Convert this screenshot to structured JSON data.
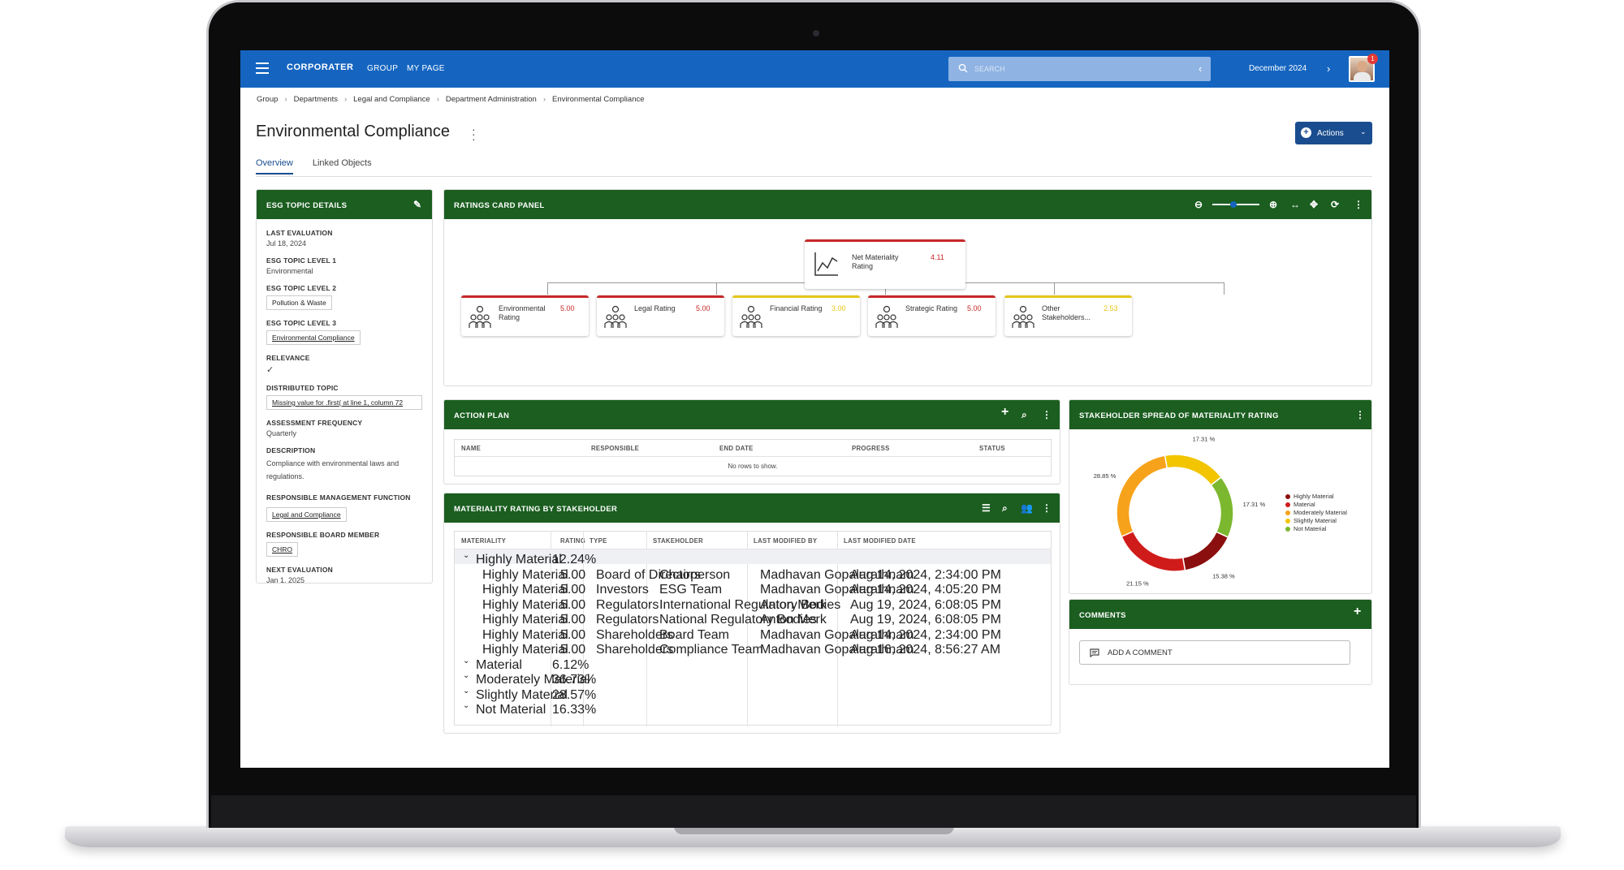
{
  "topbar": {
    "logo": "CORPORATER",
    "nav": [
      "GROUP",
      "MY PAGE"
    ],
    "search_placeholder": "SEARCH",
    "period": "December 2024",
    "notifications": "1"
  },
  "breadcrumb": [
    "Group",
    "Departments",
    "Legal and Compliance",
    "Department Administration",
    "Environmental Compliance"
  ],
  "page_title": "Environmental Compliance",
  "actions_label": "Actions",
  "tabs": [
    "Overview",
    "Linked Objects"
  ],
  "esg": {
    "header": "ESG TOPIC DETAILS",
    "last_eval_label": "LAST EVALUATION",
    "last_eval": "Jul 18, 2024",
    "level1_label": "ESG TOPIC LEVEL 1",
    "level1": "Environmental",
    "level2_label": "ESG TOPIC LEVEL 2",
    "level2": "Pollution & Waste",
    "level3_label": "ESG TOPIC LEVEL 3",
    "level3": "Environmental Compliance",
    "relevance_label": "RELEVANCE",
    "relevance": "✓",
    "distributed_label": "DISTRIBUTED TOPIC",
    "distributed": "Missing value for .first( at line 1, column 72",
    "frequency_label": "ASSESSMENT FREQUENCY",
    "frequency": "Quarterly",
    "description_label": "DESCRIPTION",
    "description": "Compliance with environmental laws and regulations.",
    "rmf_label": "RESPONSIBLE MANAGEMENT FUNCTION",
    "rmf": "Legal and Compliance",
    "board_label": "RESPONSIBLE BOARD MEMBER",
    "board": "CHRO",
    "next_eval_label": "NEXT EVALUATION",
    "next_eval": "Jan 1, 2025"
  },
  "ratings": {
    "header": "RATINGS CARD PANEL",
    "root": {
      "label": "Net Materiality Rating",
      "value": "4.11",
      "color": "#c62828"
    },
    "children": [
      {
        "label": "Environmental Rating",
        "value": "5.00",
        "color": "#c62828"
      },
      {
        "label": "Legal Rating",
        "value": "5.00",
        "color": "#c62828"
      },
      {
        "label": "Financial Rating",
        "value": "3.00",
        "color": "#e6c619"
      },
      {
        "label": "Strategic Rating",
        "value": "5.00",
        "color": "#c62828"
      },
      {
        "label": "Other Stakeholders...",
        "value": "2.53",
        "color": "#e6c619"
      }
    ]
  },
  "action_plan": {
    "header": "ACTION PLAN",
    "columns": [
      "NAME",
      "RESPONSIBLE",
      "END DATE",
      "PROGRESS",
      "STATUS"
    ],
    "empty": "No rows to show."
  },
  "materiality": {
    "header": "MATERIALITY RATING BY STAKEHOLDER",
    "columns": [
      "MATERIALITY",
      "RATING",
      "TYPE",
      "STAKEHOLDER",
      "LAST MODIFIED BY",
      "LAST MODIFIED DATE"
    ],
    "rows": [
      {
        "group": true,
        "expanded": true,
        "materiality": "Highly Material",
        "rating": "12.24%",
        "type": "",
        "stakeholder": "",
        "by": "",
        "date": ""
      },
      {
        "group": false,
        "materiality": "Highly Material",
        "rating": "5.00",
        "type": "Board of Directors",
        "stakeholder": "Chairperson",
        "by": "Madhavan Gopalarathnam",
        "date": "Aug 14, 2024, 2:34:00 PM"
      },
      {
        "group": false,
        "materiality": "Highly Material",
        "rating": "5.00",
        "type": "Investors",
        "stakeholder": "ESG Team",
        "by": "Madhavan Gopalarathnam",
        "date": "Aug 14, 2024, 4:05:20 PM"
      },
      {
        "group": false,
        "materiality": "Highly Material",
        "rating": "5.00",
        "type": "Regulators",
        "stakeholder": "International Regulatory Bodies",
        "by": "Anton Merk",
        "date": "Aug 19, 2024, 6:08:05 PM"
      },
      {
        "group": false,
        "materiality": "Highly Material",
        "rating": "5.00",
        "type": "Regulators",
        "stakeholder": "National Regulatory Bodies",
        "by": "Anton Merk",
        "date": "Aug 19, 2024, 6:08:05 PM"
      },
      {
        "group": false,
        "materiality": "Highly Material",
        "rating": "5.00",
        "type": "Shareholders",
        "stakeholder": "Board Team",
        "by": "Madhavan Gopalarathnam",
        "date": "Aug 14, 2024, 2:34:00 PM"
      },
      {
        "group": false,
        "materiality": "Highly Material",
        "rating": "5.00",
        "type": "Shareholders",
        "stakeholder": "Compliance Team",
        "by": "Madhavan Gopalarathnam",
        "date": "Aug 16, 2024, 8:56:27 AM"
      },
      {
        "group": true,
        "expanded": false,
        "materiality": "Material",
        "rating": "6.12%",
        "type": "",
        "stakeholder": "",
        "by": "",
        "date": ""
      },
      {
        "group": true,
        "expanded": false,
        "materiality": "Moderately Material",
        "rating": "36.73%",
        "type": "",
        "stakeholder": "",
        "by": "",
        "date": ""
      },
      {
        "group": true,
        "expanded": false,
        "materiality": "Slightly Material",
        "rating": "28.57%",
        "type": "",
        "stakeholder": "",
        "by": "",
        "date": ""
      },
      {
        "group": true,
        "expanded": false,
        "materiality": "Not Material",
        "rating": "16.33%",
        "type": "",
        "stakeholder": "",
        "by": "",
        "date": ""
      }
    ]
  },
  "spread": {
    "header": "STAKEHOLDER SPREAD OF MATERIALITY RATING"
  },
  "chart_data": {
    "type": "pie",
    "donut": true,
    "categories": [
      "Highly Material",
      "Material",
      "Moderately Material",
      "Slightly Material",
      "Not Material"
    ],
    "segments": [
      {
        "name": "Slightly Material",
        "value": 17.31,
        "label": "17.31 %",
        "color": "#f2c500"
      },
      {
        "name": "Not Material",
        "value": 17.31,
        "label": "17.31 %",
        "color": "#7cb82f"
      },
      {
        "name": "Highly Material",
        "value": 15.38,
        "label": "15.38 %",
        "color": "#8b0f0f"
      },
      {
        "name": "Material",
        "value": 21.15,
        "label": "21.15 %",
        "color": "#d01b1b"
      },
      {
        "name": "Moderately Material",
        "value": 28.85,
        "label": "28.85 %",
        "color": "#f7a21b"
      }
    ],
    "legend": [
      {
        "name": "Highly Material",
        "color": "#8b0f0f"
      },
      {
        "name": "Material",
        "color": "#d01b1b"
      },
      {
        "name": "Moderately Material",
        "color": "#f7a21b"
      },
      {
        "name": "Slightly Material",
        "color": "#f2c500"
      },
      {
        "name": "Not Material",
        "color": "#7cb82f"
      }
    ],
    "legend_position": "right"
  },
  "comments": {
    "header": "COMMENTS",
    "add_label": "ADD A COMMENT"
  },
  "colors": {
    "primary": "#1565c0",
    "panel_header": "#1b5e20",
    "accent": "#1a4d8f"
  }
}
